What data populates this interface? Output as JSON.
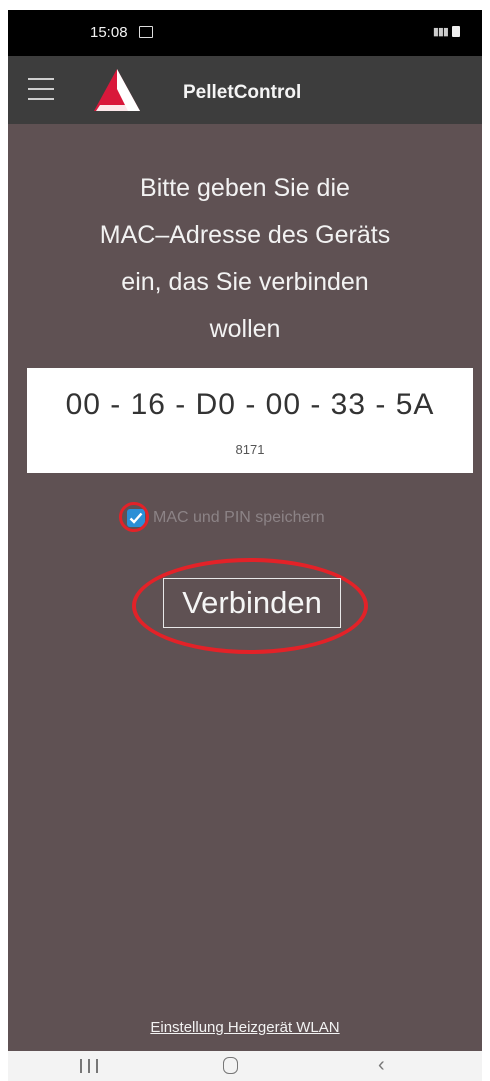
{
  "status_bar": {
    "time": "15:08",
    "image_icon": "image-notification-icon",
    "signal_icons": "signal-icon",
    "battery_icon": "battery-icon"
  },
  "app_bar": {
    "menu_icon": "hamburger-menu-icon",
    "logo_icon": "pelletcontrol-logo-icon",
    "title": "PelletControl"
  },
  "main": {
    "prompt_lines": [
      "Bitte geben Sie die",
      "MAC–Adresse des Geräts",
      "ein, das Sie verbinden",
      "wollen"
    ],
    "mac_address": "00 - 16 - D0 - 00 - 33 - 5A",
    "pin": "8171",
    "save_checkbox_checked": true,
    "save_label": "MAC und PIN speichern",
    "connect_label": "Verbinden",
    "wlan_link": "Einstellung Heizgerät WLAN"
  },
  "nav_bar": {
    "recents_icon": "recents-icon",
    "home_icon": "home-icon",
    "back_icon": "back-icon"
  },
  "colors": {
    "background": "#5f5153",
    "app_bar": "#3d3d3d",
    "checkbox": "#2b8fd6",
    "annotation": "#e32228",
    "logo_red": "#d9183b"
  }
}
